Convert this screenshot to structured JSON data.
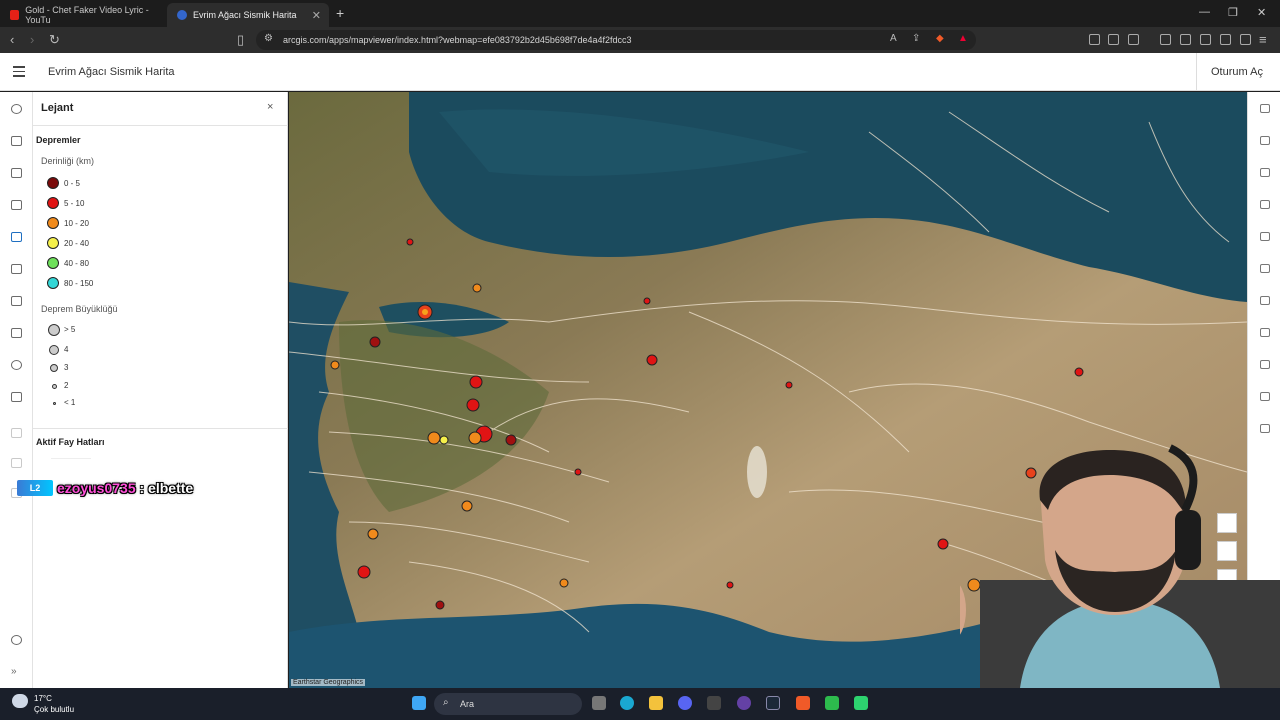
{
  "browser": {
    "tabs": [
      {
        "title": "Gold - Chet Faker Video Lyric - YouTu"
      },
      {
        "title": "Evrim Ağacı Sismik Harita"
      }
    ],
    "url": "arcgis.com/apps/mapviewer/index.html?webmap=efe083792b2d45b698f7de4a4f2fdcc3"
  },
  "app": {
    "title": "Evrim Ağacı Sismik Harita",
    "signin_label": "Oturum Aç"
  },
  "legend": {
    "title": "Lejant",
    "close": "×",
    "earthquakes": {
      "layer_name": "Depremler",
      "depth_title": "Derinliği (km)",
      "depth_items": [
        {
          "label": "0 - 5",
          "color": "#7a0a0a"
        },
        {
          "label": "5 - 10",
          "color": "#e01414"
        },
        {
          "label": "10 - 20",
          "color": "#f08a1c"
        },
        {
          "label": "20 - 40",
          "color": "#f5f04a"
        },
        {
          "label": "40 - 80",
          "color": "#6ee05a"
        },
        {
          "label": "80 - 150",
          "color": "#33d6d6"
        }
      ],
      "magnitude_title": "Deprem Büyüklüğü",
      "magnitude_items": [
        {
          "label": "> 5"
        },
        {
          "label": "4"
        },
        {
          "label": "3"
        },
        {
          "label": "2"
        },
        {
          "label": "< 1"
        }
      ]
    },
    "faults": {
      "layer_name": "Aktif Fay Hatları"
    }
  },
  "chat_overlay": {
    "badge": "L2",
    "user": "ezoyus0735",
    "message": " : elbette"
  },
  "map": {
    "attribution": "Earthstar Geographics"
  },
  "taskbar": {
    "temperature": "17°C",
    "condition": "Çok bulutlu",
    "search_label": "Ara"
  }
}
